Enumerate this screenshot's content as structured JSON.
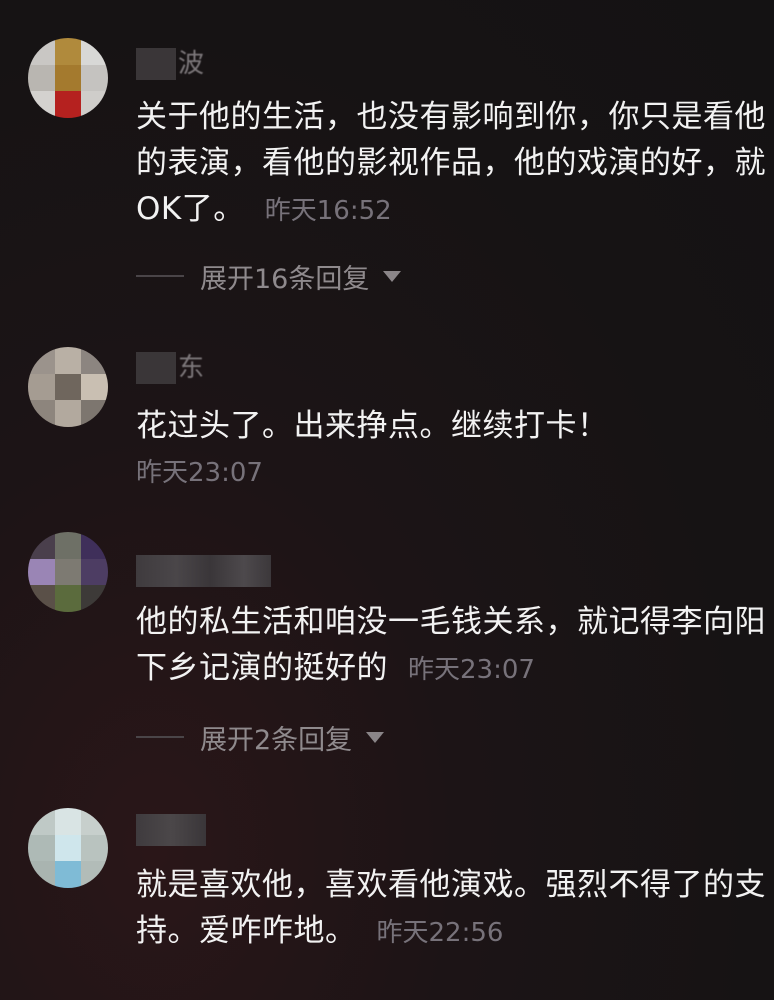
{
  "comments": [
    {
      "username_tail": "波",
      "text": "关于他的生活，也没有影响到你，你只是看他的表演，看他的影视作品，他的戏演的好，就OK了。",
      "time": "昨天16:52",
      "replies": "展开16条回复"
    },
    {
      "username_tail": "东",
      "text": "花过头了。出来挣点。继续打卡！",
      "time": "昨天23:07"
    },
    {
      "username_tail": "",
      "text": "他的私生活和咱没一毛钱关系，就记得李向阳下乡记演的挺好的",
      "time": "昨天23:07",
      "replies": "展开2条回复"
    },
    {
      "username_tail": "",
      "text": "就是喜欢他，喜欢看他演戏。强烈不得了的支持。爱咋咋地。",
      "time": "昨天22:56"
    }
  ],
  "icons": {
    "expand": "caret-down-icon"
  }
}
